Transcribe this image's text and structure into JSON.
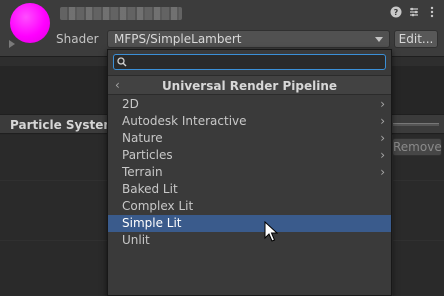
{
  "inspector": {
    "shader_label": "Shader",
    "shader_value": "MFPS/SimpleLambert",
    "edit_button": "Edit...",
    "header_icons": [
      "help-icon",
      "presets-icon",
      "more-icon"
    ],
    "ball_color": "#ff00ff"
  },
  "particle_system": {
    "title": "Particle System",
    "remove_button": "Remove"
  },
  "dropdown": {
    "search": {
      "value": "",
      "placeholder": ""
    },
    "title": "Universal Render Pipeline",
    "items": [
      {
        "label": "2D",
        "submenu": true
      },
      {
        "label": "Autodesk Interactive",
        "submenu": true
      },
      {
        "label": "Nature",
        "submenu": true
      },
      {
        "label": "Particles",
        "submenu": true
      },
      {
        "label": "Terrain",
        "submenu": true
      },
      {
        "label": "Baked Lit",
        "submenu": false
      },
      {
        "label": "Complex Lit",
        "submenu": false
      },
      {
        "label": "Simple Lit",
        "submenu": false,
        "selected": true
      },
      {
        "label": "Unlit",
        "submenu": false
      }
    ],
    "selected_color": "#3a5b8c",
    "search_focus_color": "#3b8fd6"
  }
}
